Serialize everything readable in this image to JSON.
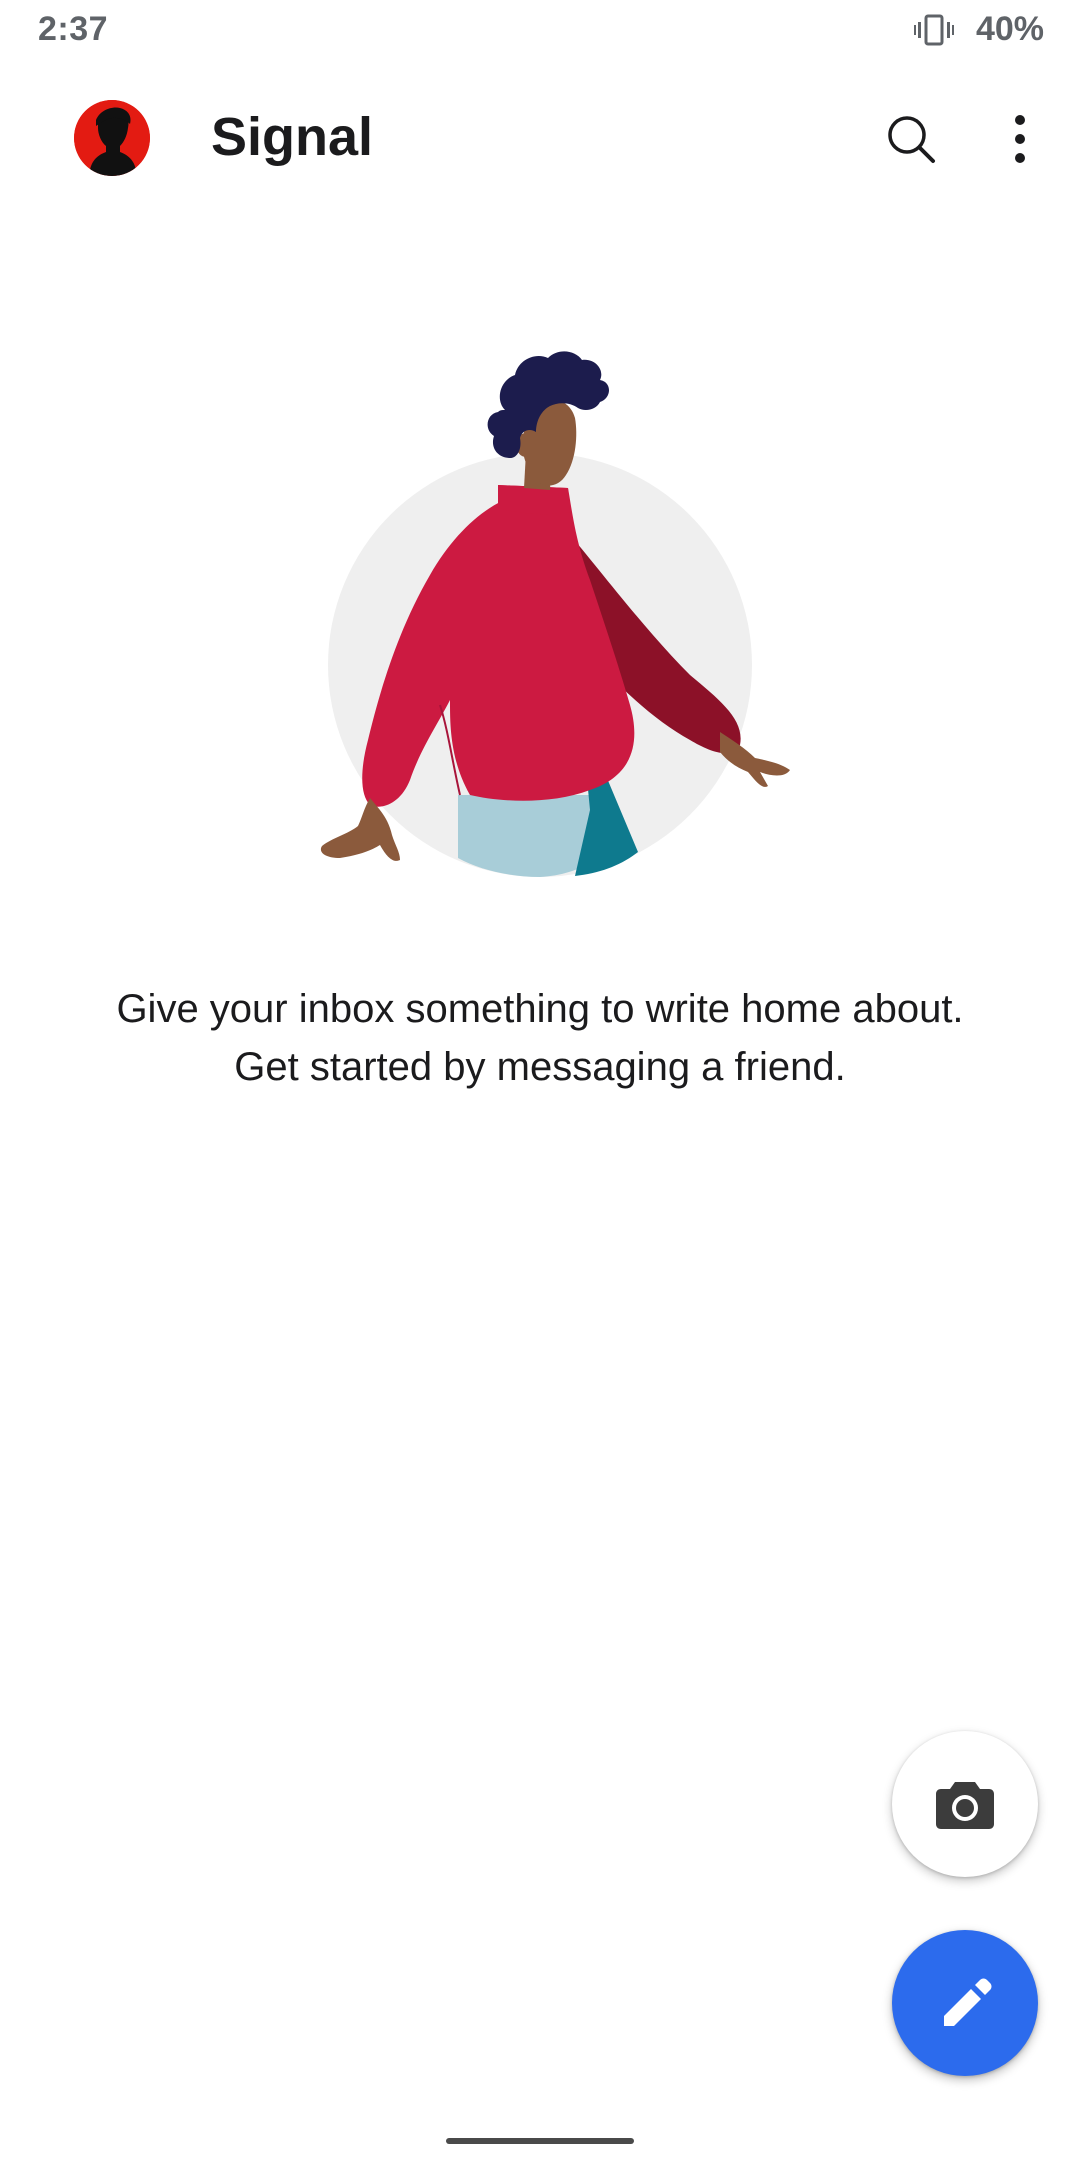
{
  "status_bar": {
    "time": "2:37",
    "battery": "40%",
    "icons": [
      "vibrate-icon"
    ]
  },
  "app_bar": {
    "title": "Signal",
    "avatar_color": "#e31b12",
    "actions": [
      "search-icon",
      "more-vert-icon"
    ]
  },
  "empty_state": {
    "message": "Give your inbox something to write home about. Get started by messaging a friend."
  },
  "fabs": {
    "camera": {
      "icon": "camera-icon",
      "background": "#ffffff"
    },
    "compose": {
      "icon": "pencil-icon",
      "background": "#2c6bed"
    }
  },
  "colors": {
    "accent": "#2c6bed",
    "text_primary": "#1b1b1d",
    "status_text": "#5f6368"
  }
}
